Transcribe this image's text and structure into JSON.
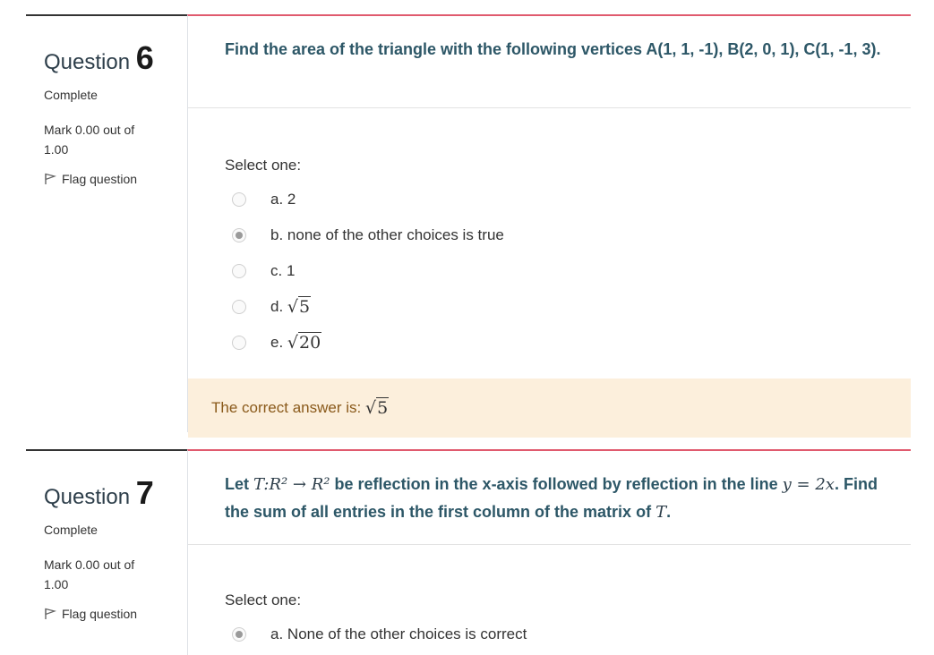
{
  "q6": {
    "label": "Question",
    "number": "6",
    "state": "Complete",
    "grade": "Mark 0.00 out of 1.00",
    "flag_label": "Flag question",
    "text": "Find the area of the triangle with the following vertices A(1, 1, -1), B(2, 0, 1), C(1, -1, 3).",
    "prompt": "Select one:",
    "options": [
      {
        "prefix": "a.",
        "text": "2"
      },
      {
        "prefix": "b.",
        "text": "none of the other choices is true"
      },
      {
        "prefix": "c.",
        "text": "1"
      },
      {
        "prefix": "d.",
        "radicand": "5"
      },
      {
        "prefix": "e.",
        "radicand": "20"
      }
    ],
    "selected": "b",
    "feedback_prefix": "The correct answer is:",
    "feedback_radicand": "5"
  },
  "q7": {
    "label": "Question",
    "number": "7",
    "state": "Complete",
    "grade": "Mark 0.00 out of 1.00",
    "flag_label": "Flag question",
    "text_part1": "Let",
    "math1": "T:R² → R²",
    "text_part2": "be reflection in the x-axis followed by reflection in the line",
    "math2": "y = 2x",
    "text_part3": ". Find the sum of all entries in the first column of the matrix of",
    "math3": "T",
    "text_part4": ".",
    "prompt": "Select one:",
    "options": [
      {
        "prefix": "a.",
        "text": "None of the other choices is correct"
      }
    ],
    "selected": "a"
  },
  "colors": {
    "question_border": "#e05a6e",
    "question_text": "#2d5767",
    "feedback_bg": "#fcefdc",
    "feedback_text": "#8a5a1b"
  },
  "icons": {
    "flag": "flag-icon"
  }
}
